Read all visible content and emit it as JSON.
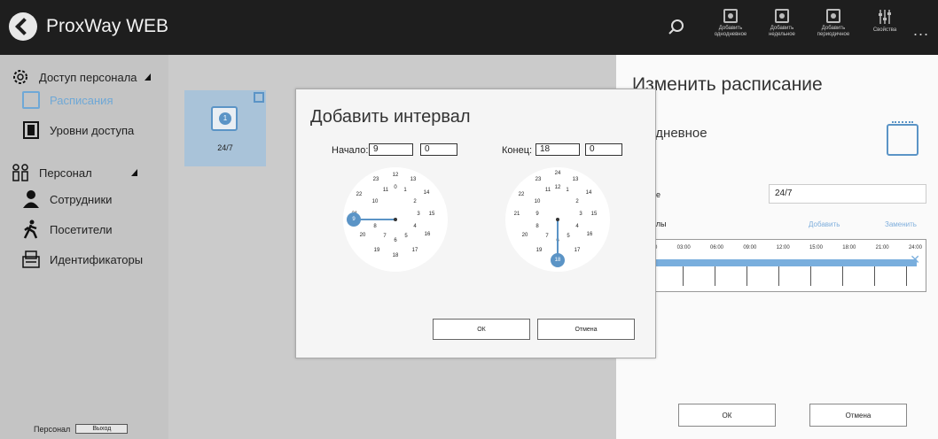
{
  "app": {
    "title": "ProxWay WEB"
  },
  "toolbar": {
    "buttons": [
      {
        "label": "Добавить однодневное"
      },
      {
        "label": "Добавить недельное"
      },
      {
        "label": "Добавить периодичное"
      },
      {
        "label": "Свойства"
      }
    ],
    "more": "..."
  },
  "sidebar": {
    "access_group": "Доступ персонала",
    "schedules": "Расписания",
    "access_levels": "Уровни доступа",
    "personnel_group": "Персонал",
    "employees": "Сотрудники",
    "visitors": "Посетители",
    "identifiers": "Идентификаторы",
    "footer_label": "Персонал",
    "logout": "Выход"
  },
  "main": {
    "tile": {
      "label": "24/7",
      "icon_number": "1"
    }
  },
  "panel": {
    "title": "Изменить расписание",
    "type": "нодневное",
    "name_label": "ание",
    "name_value": "24/7",
    "intervals_label": "рвалы",
    "add_link": "Добавить",
    "replace_link": "Заменить",
    "timeline_ticks": [
      "0",
      "03:00",
      "06:00",
      "09:00",
      "12:00",
      "15:00",
      "18:00",
      "21:00",
      "24:00"
    ],
    "ok": "ОК",
    "cancel": "Отмена"
  },
  "dialog": {
    "title": "Добавить интервал",
    "start_label": "Начало:",
    "start_hour": "9",
    "start_min": "0",
    "end_label": "Конец:",
    "end_hour": "18",
    "end_min": "0",
    "start_selected": "9",
    "end_selected": "18",
    "ok": "ОК",
    "cancel": "Отмена"
  },
  "colors": {
    "accent": "#5b94c6",
    "topbar": "#1e1e1e"
  }
}
